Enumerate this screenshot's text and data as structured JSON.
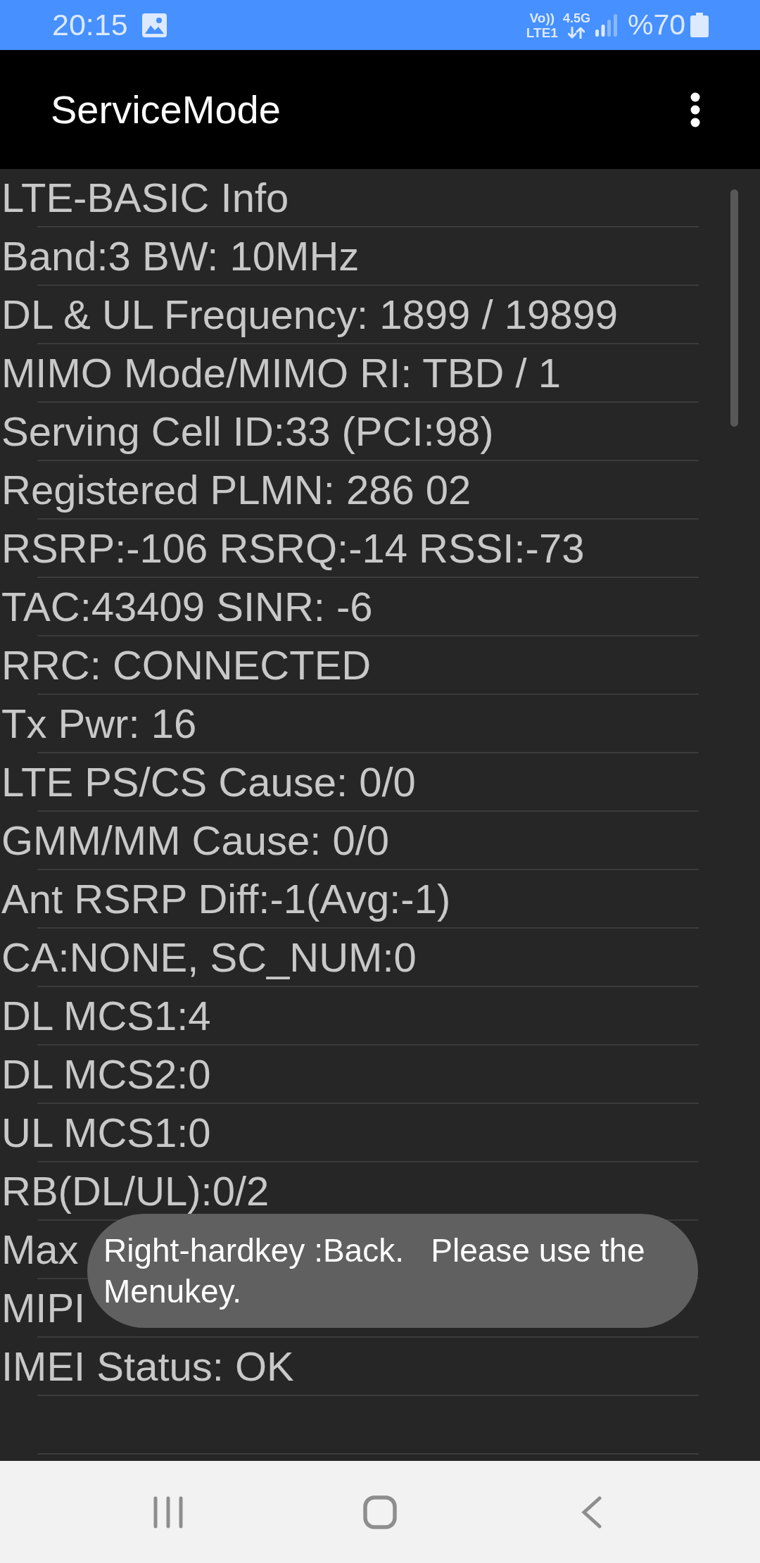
{
  "status_bar": {
    "time": "20:15",
    "volte": "Vo))",
    "lte_slot": "LTE1",
    "network": "4.5G",
    "battery": "%70"
  },
  "app_bar": {
    "title": "ServiceMode"
  },
  "info_lines": [
    "LTE-BASIC Info",
    "Band:3 BW: 10MHz",
    "DL & UL Frequency: 1899 / 19899",
    "MIMO Mode/MIMO RI: TBD / 1",
    "Serving Cell ID:33 (PCI:98)",
    "Registered PLMN: 286 02",
    "RSRP:-106 RSRQ:-14 RSSI:-73",
    "TAC:43409 SINR: -6",
    "RRC: CONNECTED",
    "Tx Pwr: 16",
    "LTE PS/CS Cause: 0/0",
    "GMM/MM Cause: 0/0",
    "Ant RSRP Diff:-1(Avg:-1)",
    "CA:NONE, SC_NUM:0",
    "DL MCS1:4",
    "DL MCS2:0",
    "UL MCS1:0",
    "RB(DL/UL):0/2",
    "Max",
    "MIPI",
    "IMEI Status: OK"
  ],
  "toast": {
    "message": "Right-hardkey :Back.   Please use the Menukey."
  }
}
